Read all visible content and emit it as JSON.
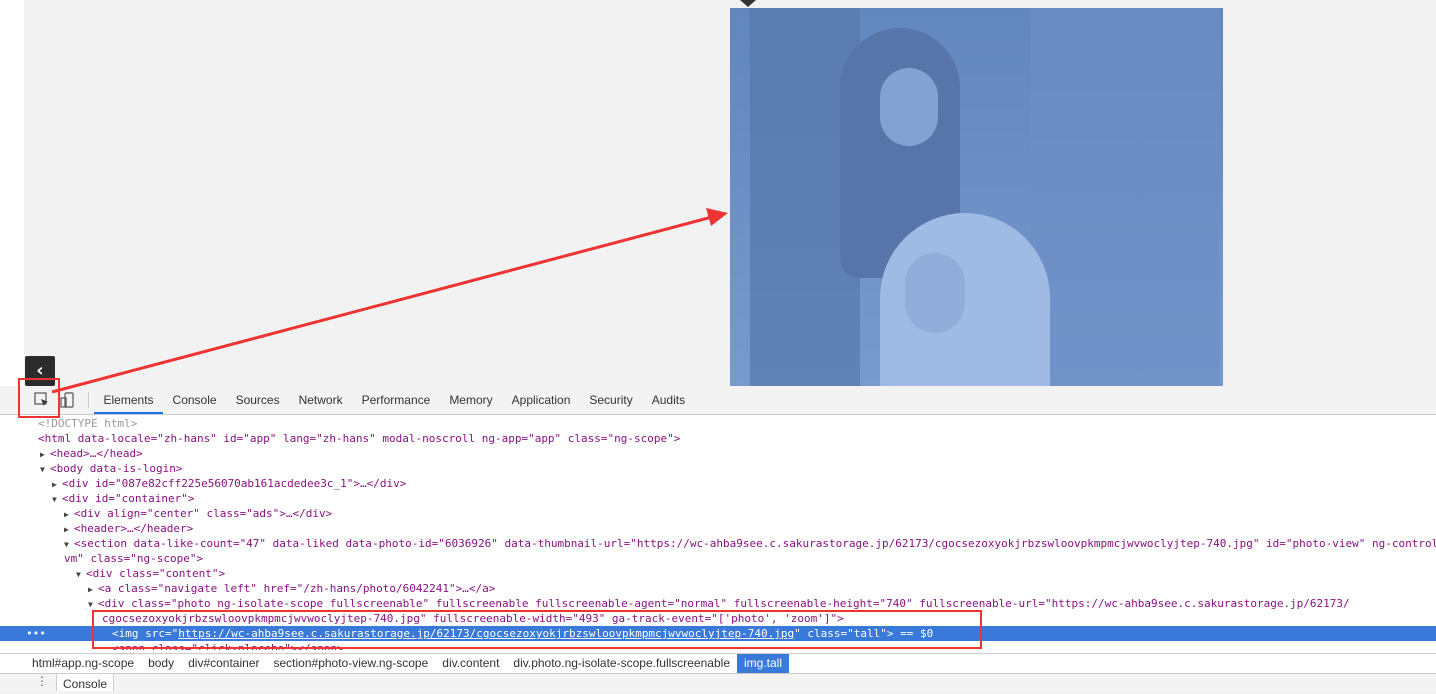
{
  "devtools": {
    "tabs": [
      "Elements",
      "Console",
      "Sources",
      "Network",
      "Performance",
      "Memory",
      "Application",
      "Security",
      "Audits"
    ],
    "active_tab": "Elements",
    "icons": {
      "inspect": "select-element-icon",
      "device": "device-toolbar-icon",
      "collapse": "chevron-left-icon"
    }
  },
  "dom_lines": {
    "l0": "<!DOCTYPE html>",
    "l1": "<html data-locale=\"zh-hans\" id=\"app\" lang=\"zh-hans\" modal-noscroll ng-app=\"app\" class=\"ng-scope\">",
    "l2": "<head>…</head>",
    "l3": "<body data-is-login>",
    "l4": "<div id=\"087e82cff225e56070ab161acdedee3c_1\">…</div>",
    "l5": "<div id=\"container\">",
    "l6": "<div align=\"center\" class=\"ads\">…</div>",
    "l7": "<header>…</header>",
    "l8": "<section data-like-count=\"47\" data-liked data-photo-id=\"6036926\" data-thumbnail-url=\"https://wc-ahba9see.c.sakurastorage.jp/62173/cgocsezoxyokjrbzswloovpkmpmcjwvwoclyjtep-740.jpg\" id=\"photo-view\" ng-controll",
    "l9": "vm\" class=\"ng-scope\">",
    "l10": "<div class=\"content\">",
    "l11": "<a class=\"navigate left\" href=\"/zh-hans/photo/6042241\">…</a>",
    "l12": "<div class=\"photo ng-isolate-scope fullscreenable\" fullscreenable fullscreenable-agent=\"normal\" fullscreenable-height=\"740\" fullscreenable-url=\"https://wc-ahba9see.c.sakurastorage.jp/62173/",
    "l13": "cgocsezoxyokjrbzswloovpkmpmcjwvwoclyjtep-740.jpg\" fullscreenable-width=\"493\" ga-track-event=\"['photo', 'zoom']\">",
    "l14_pre": "<img src=\"",
    "l14_url": "https://wc-ahba9see.c.sakurastorage.jp/62173/cgocsezoxyokjrbzswloovpkmpmcjwvwoclyjtep-740.jpg",
    "l14_post": "\" class=\"tall\"> == $0",
    "l14_dots": "•••",
    "l15": "<span class=\"click-placebo\"></span>"
  },
  "breadcrumbs": [
    "html#app.ng-scope",
    "body",
    "div#container",
    "section#photo-view.ng-scope",
    "div.content",
    "div.photo.ng-isolate-scope.fullscreenable",
    "img.tall"
  ],
  "drawer": {
    "menu": "⋮",
    "tab": "Console"
  },
  "colors": {
    "accent": "#3879d9",
    "annotation": "#ee3333"
  }
}
